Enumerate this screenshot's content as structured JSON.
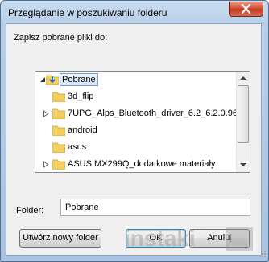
{
  "window": {
    "title": "Przeglądanie w poszukiwaniu folderu"
  },
  "prompt": "Zapisz pobrane pliki do:",
  "tree": {
    "items": [
      {
        "label": "Pobrane",
        "expandable": true,
        "expanded": true,
        "selected": true,
        "level": 0,
        "icon": "download-folder-icon"
      },
      {
        "label": "3d_flip",
        "expandable": false,
        "level": 1,
        "icon": "folder-icon"
      },
      {
        "label": "7UPG_Alps_Bluetooth_driver_6.2_6.2.0.96",
        "expandable": true,
        "expanded": false,
        "level": 1,
        "icon": "folder-icon"
      },
      {
        "label": "android",
        "expandable": false,
        "level": 1,
        "icon": "folder-icon"
      },
      {
        "label": "asus",
        "expandable": false,
        "level": 1,
        "icon": "folder-icon"
      },
      {
        "label": "ASUS MX299Q_dodatkowe materiały",
        "expandable": true,
        "expanded": false,
        "level": 1,
        "icon": "folder-icon"
      }
    ]
  },
  "folder_field": {
    "label": "Folder:",
    "value": "Pobrane"
  },
  "buttons": {
    "new_folder": "Utwórz nowy folder",
    "ok": "OK",
    "cancel": "Anuluj"
  },
  "watermark": {
    "text": "instaki"
  },
  "colors": {
    "title_bar": "#b9cfe8",
    "close_button": "#c9452b",
    "selection": "#d4e5f7",
    "folder_yellow": "#f2cf5f"
  }
}
